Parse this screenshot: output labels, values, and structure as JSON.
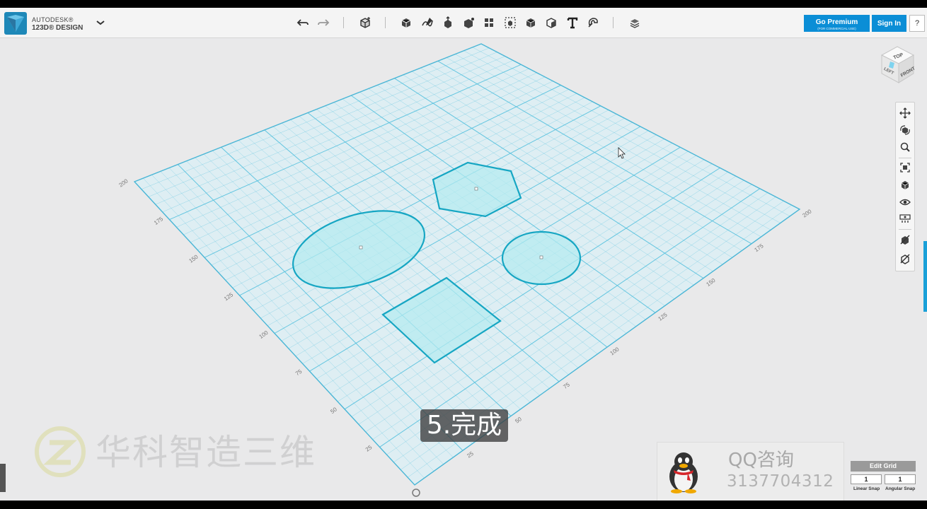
{
  "app": {
    "brand_line1": "AUTODESK®",
    "brand_line2": "123D® DESIGN"
  },
  "toolbar": {
    "icons": [
      "undo-icon",
      "redo-icon",
      "transform-icon",
      "primitives-icon",
      "sketch-icon",
      "construct-icon",
      "modify-icon",
      "pattern-icon",
      "grouping-icon",
      "combine-icon",
      "measure-icon",
      "text-icon",
      "snap-icon",
      "materials-icon"
    ]
  },
  "header": {
    "premium_label": "Go Premium",
    "premium_sub": "(FOR COMMERCIAL USE)",
    "signin_label": "Sign In",
    "help_label": "?"
  },
  "viewcube": {
    "top": "TOP",
    "left": "LEFT",
    "front": "FRONT"
  },
  "grid": {
    "left_axis_labels": [
      "200",
      "175",
      "150",
      "125",
      "100",
      "75",
      "50",
      "25"
    ],
    "right_axis_labels": [
      "25",
      "50",
      "75",
      "100",
      "125",
      "150",
      "175",
      "200"
    ],
    "line_color": "#56c1de",
    "fill_color": "#dceff5"
  },
  "sketches": {
    "fill_color": "#b3ebef",
    "stroke_color": "#16a6c3",
    "shapes": [
      "ellipse",
      "hexagon",
      "circle",
      "square"
    ]
  },
  "nav_panel": {
    "icons": [
      "pan-icon",
      "orbit-icon",
      "zoom-icon",
      "fit-icon",
      "view-icon",
      "visibility-icon",
      "material-view-icon",
      "outline-icon",
      "solid-render-icon"
    ]
  },
  "caption": "5.完成",
  "watermark": "华科智造三维",
  "contact": {
    "title": "QQ咨询",
    "number": "3137704312"
  },
  "grid_settings": {
    "edit_grid_label": "Edit Grid",
    "linear_snap_value": "1",
    "angular_snap_value": "1",
    "linear_snap_label": "Linear Snap",
    "angular_snap_label": "Angular Snap"
  }
}
